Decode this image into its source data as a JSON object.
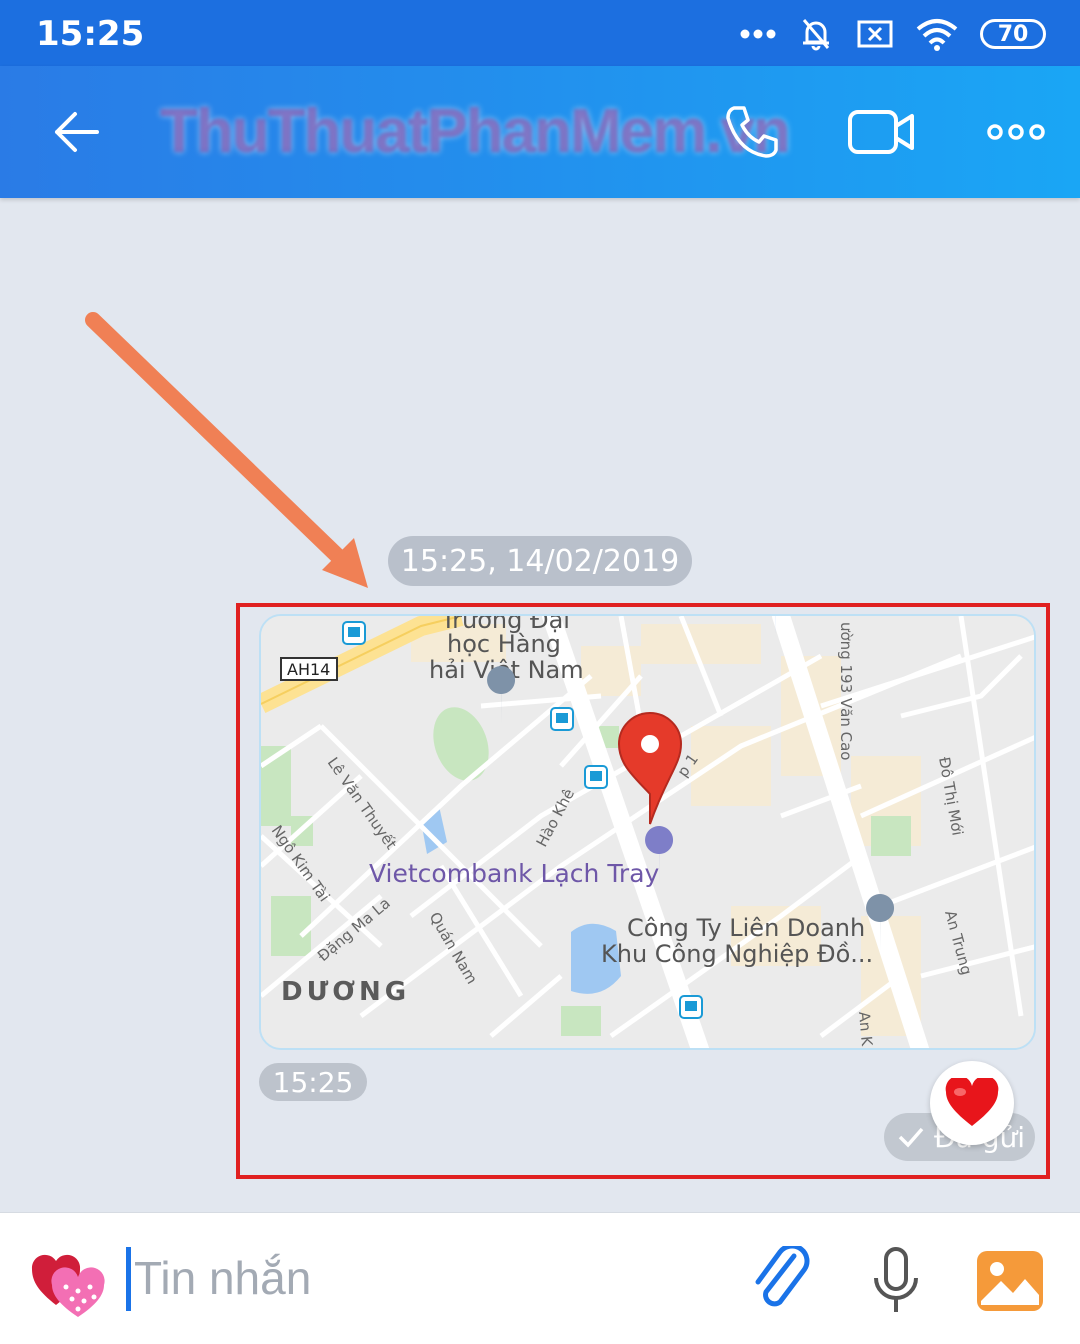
{
  "status_bar": {
    "time": "15:25",
    "battery": "70",
    "icons": [
      "more-dots-icon",
      "bell-off-icon",
      "sim-x-icon",
      "wifi-icon",
      "battery-icon"
    ]
  },
  "header": {
    "contact_name": "ThuThuatPhanMem.vn",
    "icons": [
      "back-arrow-icon",
      "phone-icon",
      "video-camera-icon",
      "more-options-icon"
    ]
  },
  "chat": {
    "date_stamp": "15:25, 14/02/2019",
    "message": {
      "type": "location",
      "map_labels": {
        "poi_top": "Trường Đại",
        "poi_line1": "học Hàng",
        "poi_line2": "hải Việt Nam",
        "road_shield": "AH14",
        "bank": "Vietcombank Lạch Tray",
        "company_line1": "Công Ty Liên Doanh",
        "company_line2": "Khu Công Nghiệp Đồ...",
        "district": "DƯƠNG",
        "street_le_van_thuyet": "Lê Văn Thuyết",
        "street_ngo_kim_tai": "Ngô Kim Tài",
        "street_dang_ma_la": "Đặng Ma La",
        "street_quan_nam": "Quán Nam",
        "street_hao_khe": "Hào Khê",
        "street_van_cao": "ường 193 Văn Cao",
        "street_do_thi_moi": "Đô Thị Mới",
        "street_an_trung": "An Trung",
        "street_an_k": "An K",
        "street_p1": "p 1"
      },
      "time": "15:25",
      "status": "Đã gửi"
    },
    "accent_colors": {
      "highlight": "#e02020",
      "arrow": "#f08055",
      "pin": "#e53a2a"
    }
  },
  "input_bar": {
    "placeholder": "Tin nhắn",
    "icons": [
      "sticker-heart-icon",
      "paperclip-icon",
      "microphone-icon",
      "gallery-icon"
    ]
  }
}
